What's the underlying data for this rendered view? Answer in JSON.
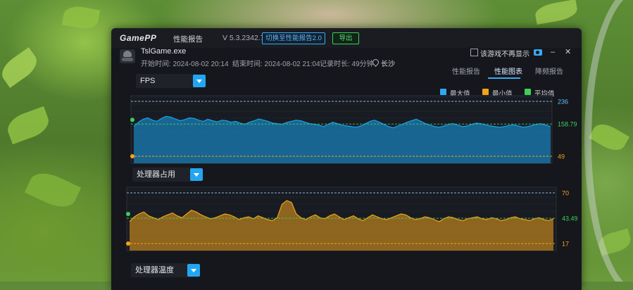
{
  "header": {
    "logo": "GamePP",
    "title": "性能报告",
    "version": "V 5.3.2342.719",
    "switch_button": "切换至性能报告2.0",
    "export_button": "导出",
    "hide_checkbox_label": "该游戏不再显示"
  },
  "session": {
    "exe": "TslGame.exe",
    "start": "开始时间: 2024-08-02 20:14",
    "end": "结束时间: 2024-08-02 21:04",
    "duration": "记录时长: 49分钟",
    "location": "长沙"
  },
  "tabs": [
    {
      "label": "性能报告",
      "active": false
    },
    {
      "label": "性能图表",
      "active": true
    },
    {
      "label": "降频报告",
      "active": false
    }
  ],
  "legend": [
    {
      "label": "最大值",
      "color": "#2ea8f2"
    },
    {
      "label": "最小值",
      "color": "#f5a31a"
    },
    {
      "label": "平均值",
      "color": "#3ecf5a"
    }
  ],
  "panels": [
    {
      "label": "FPS"
    },
    {
      "label": "处理器占用"
    },
    {
      "label": "处理器温度"
    }
  ],
  "colors": {
    "fps": "#1aa3ec",
    "cpu": "#f0a21c",
    "avg": "#3ecf5a",
    "accent": "#22a6f3"
  },
  "chart_data": [
    {
      "type": "area",
      "title": "FPS",
      "max": "236",
      "avg": "158.79",
      "min": "49",
      "ylim": [
        49,
        236
      ],
      "values": [
        150,
        165,
        175,
        180,
        172,
        168,
        178,
        185,
        182,
        176,
        170,
        174,
        180,
        178,
        172,
        168,
        175,
        170,
        166,
        172,
        170,
        165,
        168,
        162,
        158,
        165,
        170,
        176,
        172,
        168,
        162,
        160,
        158,
        164,
        168,
        172,
        170,
        165,
        160,
        158,
        155,
        150,
        158,
        165,
        160,
        155,
        152,
        150,
        148,
        152,
        160,
        168,
        172,
        165,
        158,
        150,
        146,
        152,
        158,
        165,
        170,
        175,
        168,
        160,
        155,
        150,
        148,
        152,
        158,
        160,
        155,
        150,
        152,
        158,
        162,
        160,
        156,
        152,
        150,
        148,
        150,
        154,
        156,
        152,
        148,
        150,
        154,
        158,
        160,
        155,
        150
      ]
    },
    {
      "type": "area",
      "title": "处理器占用",
      "max": "70",
      "avg": "43.49",
      "min": "17",
      "ylim": [
        17,
        70
      ],
      "values": [
        40,
        45,
        48,
        50,
        46,
        44,
        42,
        45,
        47,
        49,
        46,
        44,
        48,
        52,
        50,
        47,
        45,
        43,
        44,
        46,
        48,
        47,
        45,
        42,
        44,
        45,
        43,
        46,
        44,
        42,
        41,
        44,
        58,
        62,
        60,
        48,
        44,
        42,
        45,
        47,
        44,
        43,
        46,
        48,
        45,
        42,
        44,
        46,
        43,
        41,
        44,
        47,
        45,
        43,
        42,
        44,
        46,
        48,
        47,
        44,
        42,
        43,
        45,
        44,
        42,
        40,
        43,
        45,
        44,
        42,
        41,
        43,
        44,
        45,
        43,
        42,
        44,
        43,
        41,
        42,
        44,
        45,
        43,
        42,
        41,
        43,
        44,
        42,
        41,
        43
      ]
    }
  ]
}
